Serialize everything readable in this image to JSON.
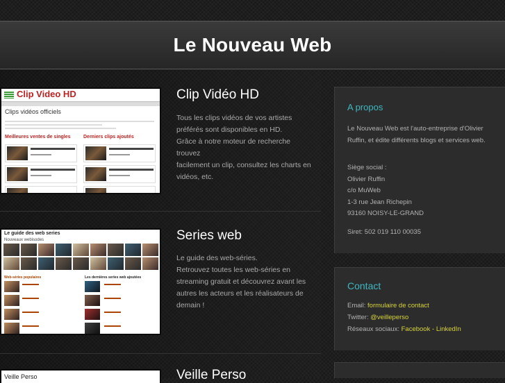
{
  "header": {
    "title": "Le Nouveau Web"
  },
  "posts": [
    {
      "title": "Clip Vidéo HD",
      "desc": [
        "Tous les clips vidéos de vos artistes",
        "préférés sont disponibles en HD.",
        "Grâce à notre moteur de recherche trouvez",
        "facilement un clip, consultez les charts en",
        "vidéos, etc."
      ],
      "thumb": {
        "brand": "Clip Video HD",
        "subtitle": "Clips vidéos officiels",
        "col1": "Meilleures ventes de singles",
        "col2": "Derniers clips ajoutés"
      }
    },
    {
      "title": "Series web",
      "desc": [
        "Le guide des web-séries.",
        "Retrouvez toutes les web-séries en",
        "streaming gratuit et découvrez avant les",
        "autres les acteurs et les réalisateurs de",
        "demain !"
      ],
      "thumb": {
        "title": "Le guide des web series",
        "subtitle": "Nouveaux webisodes",
        "col1": "Web-séries populaires",
        "col2": "Les dernières series web ajoutées"
      }
    },
    {
      "title": "Veille Perso",
      "thumb": {
        "title": "Veille Perso"
      }
    }
  ],
  "sidebar": {
    "about": {
      "title": "A propos",
      "intro": "Le Nouveau Web est l'auto-entreprise d'Olivier Ruffin, et édite différents blogs et services web.",
      "address": [
        "Siège social :",
        "Olivier Ruffin",
        "c/o MuWeb",
        "1-3 rue Jean Richepin",
        "93160 NOISY-LE-GRAND"
      ],
      "siret": "Siret: 502 019 110 00035"
    },
    "contact": {
      "title": "Contact",
      "email_label": "Email: ",
      "email_link": "formulaire de contact",
      "twitter_label": "Twitter: ",
      "twitter_link": "@veilleperso",
      "social_label": "Réseaux sociaux: ",
      "facebook": "Facebook",
      "social_sep": " - ",
      "linkedin": "LinkedIn"
    }
  },
  "colors": {
    "accent": "#3fb7c0",
    "link": "#d8d43a",
    "brand_red": "#b22222"
  }
}
